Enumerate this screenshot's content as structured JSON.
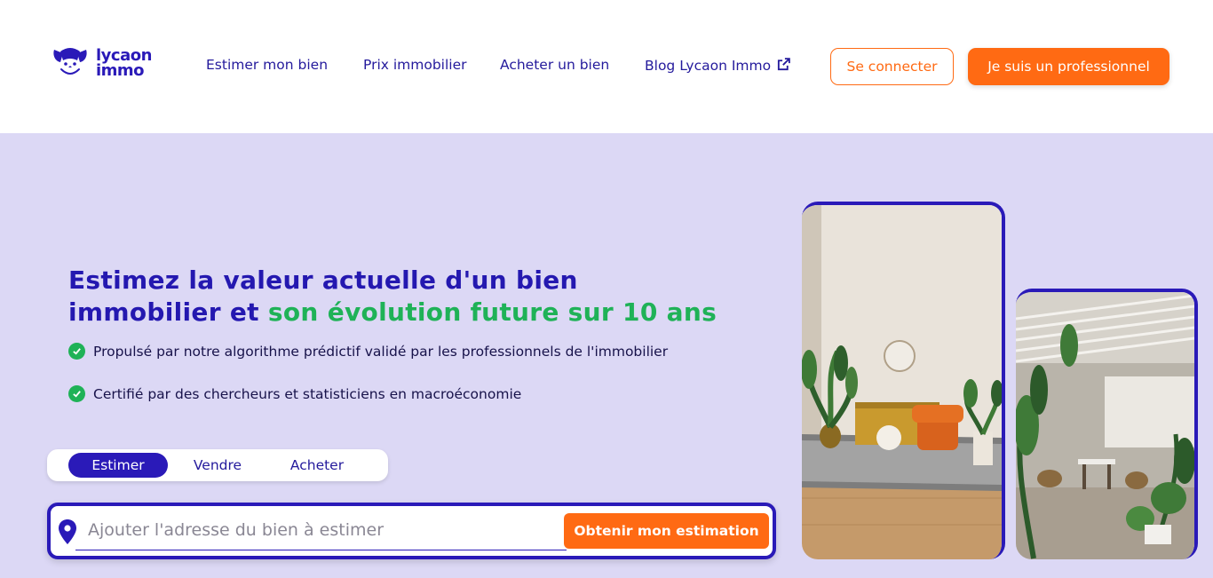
{
  "header": {
    "logo": {
      "line1": "lycaon",
      "line2": "immo",
      "icon": "dog-face-logo-icon"
    },
    "nav": [
      {
        "label": "Estimer mon bien"
      },
      {
        "label": "Prix immobilier"
      },
      {
        "label": "Acheter un bien"
      },
      {
        "label": "Blog Lycaon Immo",
        "icon": "external-link-icon"
      }
    ],
    "login_label": "Se connecter",
    "pro_label": "Je suis un professionnel"
  },
  "hero": {
    "headline_line1": "Estimez la valeur actuelle d'un bien",
    "headline_line2_start": "immobilier et ",
    "headline_line2_highlight": "son évolution future sur 10 ans",
    "features": [
      "Propulsé par notre algorithme prédictif validé par les professionnels de l'immobilier",
      "Certifié par des chercheurs et statisticiens en macroéconomie"
    ],
    "tabs": [
      {
        "label": "Estimer",
        "active": true
      },
      {
        "label": "Vendre",
        "active": false
      },
      {
        "label": "Acheter",
        "active": false
      }
    ],
    "search": {
      "placeholder": "Ajouter l'adresse du bien à estimer",
      "value": "",
      "button_label": "Obtenir mon estimation",
      "icon": "map-pin-icon"
    }
  },
  "colors": {
    "brand_primary": "#2a1ab8",
    "accent_orange": "#ff6a13",
    "accent_green": "#1fb257",
    "hero_bg": "#dcd8f5"
  }
}
